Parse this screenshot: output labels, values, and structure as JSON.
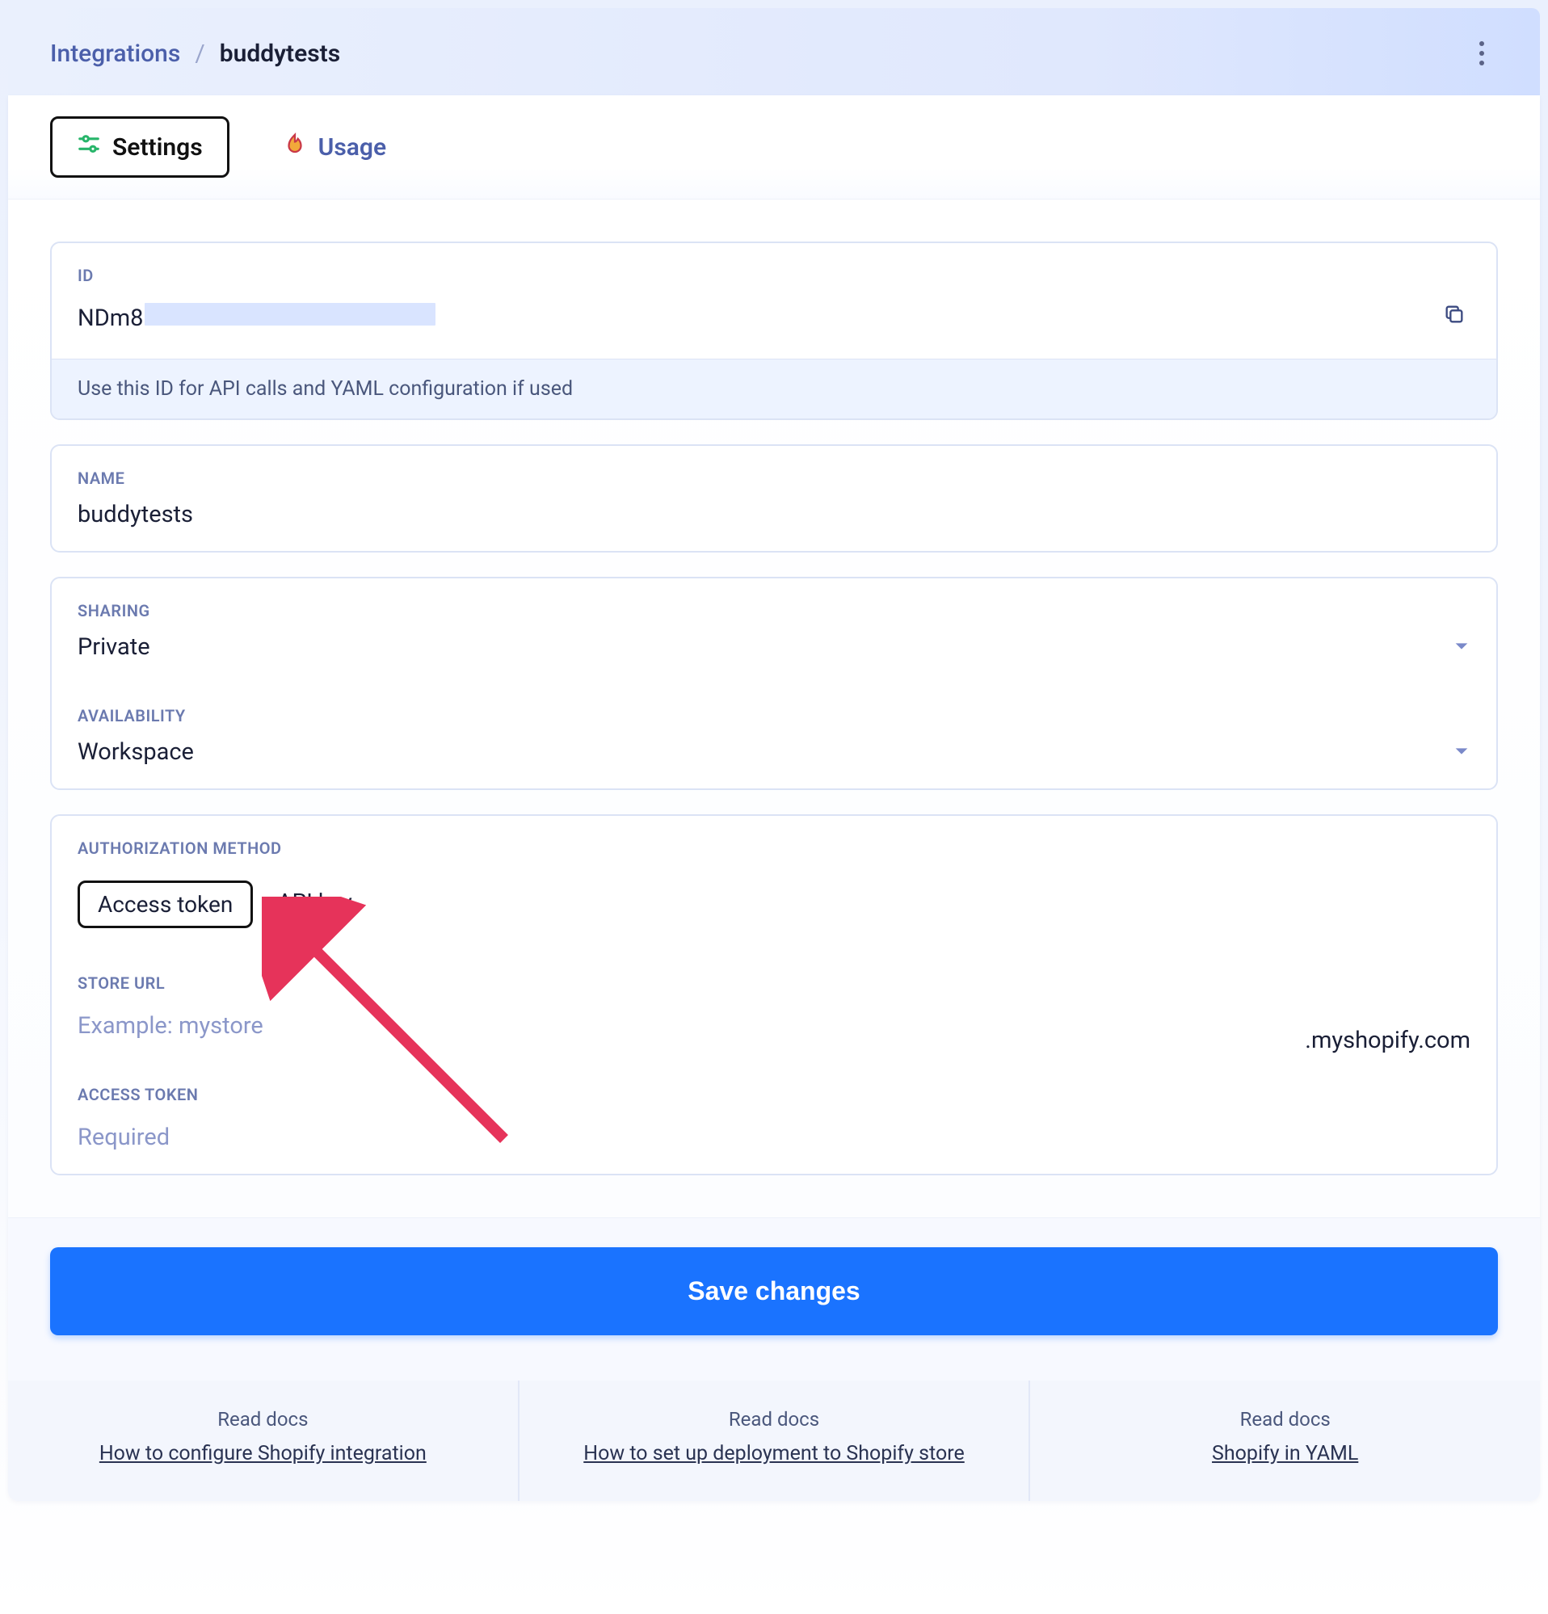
{
  "breadcrumb": {
    "parent": "Integrations",
    "sep": "/",
    "current": "buddytests"
  },
  "tabs": {
    "settings": "Settings",
    "usage": "Usage"
  },
  "id_section": {
    "label": "ID",
    "prefix": "NDm8",
    "hint": "Use this ID for API calls and YAML configuration if used"
  },
  "name_section": {
    "label": "NAME",
    "value": "buddytests"
  },
  "sharing": {
    "label": "SHARING",
    "value": "Private"
  },
  "availability": {
    "label": "AVAILABILITY",
    "value": "Workspace"
  },
  "auth": {
    "label": "AUTHORIZATION METHOD",
    "option_token": "Access token",
    "option_apikey": "API key"
  },
  "store_url": {
    "label": "STORE URL",
    "placeholder": "Example: mystore",
    "suffix": ".myshopify.com"
  },
  "access_token": {
    "label": "ACCESS TOKEN",
    "placeholder": "Required"
  },
  "save_label": "Save changes",
  "docs": {
    "read_label": "Read docs",
    "links": [
      "How to configure Shopify integration",
      "How to set up deployment to Shopify store",
      "Shopify in YAML"
    ]
  }
}
